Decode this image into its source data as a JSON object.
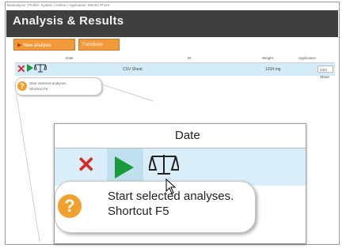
{
  "titlebar": {
    "text": "Bioanalyzer | Profile: System | Online | Application: Electro Phore"
  },
  "app": {
    "title": "Analysis & Results"
  },
  "toolbar": {
    "new_analysis_label": "New analysis",
    "second_label": "Functions"
  },
  "table_header": {
    "col1": "Date",
    "col2": "ID",
    "col3": "Weight",
    "col4": "Application"
  },
  "row": {
    "name": "CSV Sheet",
    "weight": "1034 mg",
    "application": "CSV Sheet"
  },
  "small_tooltip": {
    "line1": "Start selected analyses.",
    "line2": "Shortcut F5"
  },
  "zoom": {
    "header": "Date",
    "tooltip_line1": "Start selected analyses.",
    "tooltip_line2": "Shortcut F5",
    "help_glyph": "?"
  },
  "colors": {
    "delete_red": "#d42b2b",
    "play_green": "#1a9a3c",
    "accent_orange": "#f29a3a",
    "row_blue": "#d9eef9",
    "help_orange": "#f2a02d"
  },
  "icons": {
    "delete": "close-x-icon",
    "start": "play-icon",
    "compare": "balance-scale-icon",
    "help": "question-mark-icon"
  }
}
